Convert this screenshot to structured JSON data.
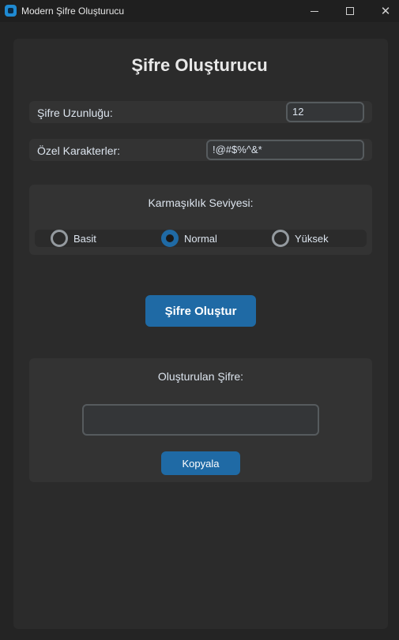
{
  "window": {
    "title": "Modern Şifre Oluşturucu",
    "icon": "app-icon",
    "controls": {
      "minimize": "minimize-icon",
      "maximize": "maximize-icon",
      "close_glyph": "✕"
    }
  },
  "main": {
    "title": "Şifre Oluşturucu",
    "length": {
      "label": "Şifre Uzunluğu:",
      "value": "12"
    },
    "special_chars": {
      "label": "Özel Karakterler:",
      "value": "!@#$%^&*"
    },
    "complexity": {
      "title": "Karmaşıklık Seviyesi:",
      "options": [
        {
          "label": "Basit",
          "selected": false
        },
        {
          "label": "Normal",
          "selected": true
        },
        {
          "label": "Yüksek",
          "selected": false
        }
      ]
    },
    "generate_button": "Şifre Oluştur",
    "result": {
      "title": "Oluşturulan Şifre:",
      "value": "",
      "copy_button": "Kopyala"
    }
  },
  "colors": {
    "accent": "#1f6aa5",
    "background": "#242424",
    "frame": "#2b2b2b",
    "panel": "#333333",
    "entry_border": "#565b5e",
    "text": "#dce4ee"
  }
}
